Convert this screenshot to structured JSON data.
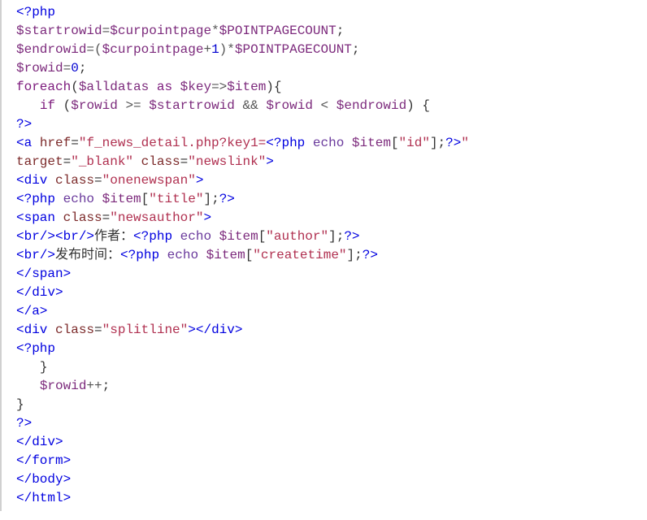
{
  "code": {
    "lines": [
      {
        "html": "<span class='tag'>&lt;?php</span>"
      },
      {
        "html": "<span class='var'>$startrowid</span><span class='op'>=</span><span class='var'>$curpointpage</span><span class='op'>*</span><span class='var'>$POINTPAGECOUNT</span><span class='plain'>;</span>"
      },
      {
        "html": "<span class='var'>$endrowid</span><span class='op'>=(</span><span class='var'>$curpointpage</span><span class='op'>+</span><span class='num'>1</span><span class='op'>)*</span><span class='var'>$POINTPAGECOUNT</span><span class='plain'>;</span>"
      },
      {
        "html": "<span class='var'>$rowid</span><span class='op'>=</span><span class='num'>0</span><span class='plain'>;</span>"
      },
      {
        "html": "<span class='kw'>foreach</span><span class='plain'>(</span><span class='var'>$alldatas</span> <span class='kw'>as</span> <span class='var'>$key</span><span class='op'>=&gt;</span><span class='var'>$item</span><span class='plain'>){</span>"
      },
      {
        "html": "   <span class='kw'>if</span> <span class='plain'>(</span><span class='var'>$rowid</span> <span class='op'>&gt;=</span> <span class='var'>$startrowid</span> <span class='op'>&amp;&amp;</span> <span class='var'>$rowid</span> <span class='op'>&lt;</span> <span class='var'>$endrowid</span><span class='plain'>) {</span>"
      },
      {
        "html": "<span class='tag'>?&gt;</span>"
      },
      {
        "html": "<span class='tag'>&lt;a</span> <span class='attr'>href</span>=<span class='str'>\"f_news_detail.php?key1=</span><span class='tag'>&lt;?php</span> <span class='func'>echo</span> <span class='var'>$item</span><span class='plain'>[</span><span class='idx'>\"id\"</span><span class='plain'>];</span><span class='tag'>?&gt;</span><span class='str'>\"</span>"
      },
      {
        "html": "<span class='attr'>target</span>=<span class='str'>\"_blank\"</span> <span class='attr'>class</span>=<span class='str'>\"newslink\"</span><span class='tag'>&gt;</span>"
      },
      {
        "html": "<span class='tag'>&lt;div</span> <span class='attr'>class</span>=<span class='str'>\"onenewspan\"</span><span class='tag'>&gt;</span>"
      },
      {
        "html": "<span class='tag'>&lt;?php</span> <span class='func'>echo</span> <span class='var'>$item</span><span class='plain'>[</span><span class='idx'>\"title\"</span><span class='plain'>];</span><span class='tag'>?&gt;</span>"
      },
      {
        "html": "<span class='tag'>&lt;span</span> <span class='attr'>class</span>=<span class='str'>\"newsauthor\"</span><span class='tag'>&gt;</span>"
      },
      {
        "html": "<span class='tag'>&lt;br/&gt;&lt;br/&gt;</span><span class='plain'>作者：</span><span class='tag'>&lt;?php</span> <span class='func'>echo</span> <span class='var'>$item</span><span class='plain'>[</span><span class='idx'>\"author\"</span><span class='plain'>];</span><span class='tag'>?&gt;</span>"
      },
      {
        "html": "<span class='tag'>&lt;br/&gt;</span><span class='plain'>发布时间：</span><span class='tag'>&lt;?php</span> <span class='func'>echo</span> <span class='var'>$item</span><span class='plain'>[</span><span class='idx'>\"createtime\"</span><span class='plain'>];</span><span class='tag'>?&gt;</span>"
      },
      {
        "html": "<span class='tag'>&lt;/span&gt;</span>"
      },
      {
        "html": "<span class='tag'>&lt;/div&gt;</span>"
      },
      {
        "html": "<span class='tag'>&lt;/a&gt;</span>"
      },
      {
        "html": "<span class='tag'>&lt;div</span> <span class='attr'>class</span>=<span class='str'>\"splitline\"</span><span class='tag'>&gt;&lt;/div&gt;</span>"
      },
      {
        "html": "<span class='tag'>&lt;?php</span>"
      },
      {
        "html": "   <span class='plain'>}</span>"
      },
      {
        "html": "   <span class='var'>$rowid</span><span class='op'>++</span><span class='plain'>;</span>"
      },
      {
        "html": "<span class='plain'>}</span>"
      },
      {
        "html": "<span class='tag'>?&gt;</span>"
      },
      {
        "html": "<span class='tag'>&lt;/div&gt;</span>"
      },
      {
        "html": "<span class='tag'>&lt;/form&gt;</span>"
      },
      {
        "html": "<span class='tag'>&lt;/body&gt;</span>"
      },
      {
        "html": "<span class='tag'>&lt;/html&gt;</span>"
      }
    ]
  },
  "raw_code_lines": [
    "<?php",
    "$startrowid=$curpointpage*$POINTPAGECOUNT;",
    "$endrowid=($curpointpage+1)*$POINTPAGECOUNT;",
    "$rowid=0;",
    "foreach($alldatas as $key=>$item){",
    "   if ($rowid >= $startrowid && $rowid < $endrowid) {",
    "?>",
    "<a href=\"f_news_detail.php?key1=<?php echo $item[\"id\"];?>\"",
    "target=\"_blank\" class=\"newslink\">",
    "<div class=\"onenewspan\">",
    "<?php echo $item[\"title\"];?>",
    "<span class=\"newsauthor\">",
    "<br/><br/>作者：<?php echo $item[\"author\"];?>",
    "<br/>发布时间：<?php echo $item[\"createtime\"];?>",
    "</span>",
    "</div>",
    "</a>",
    "<div class=\"splitline\"></div>",
    "<?php",
    "   }",
    "   $rowid++;",
    "}",
    "?>",
    "</div>",
    "</form>",
    "</body>",
    "</html>"
  ]
}
